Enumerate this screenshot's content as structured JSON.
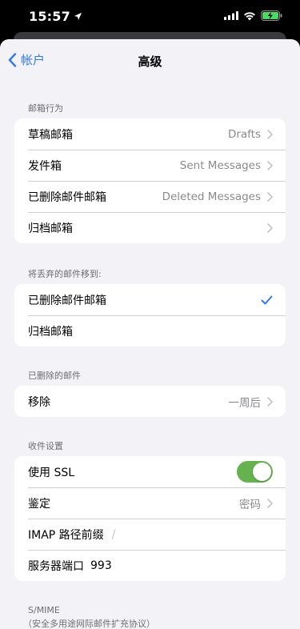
{
  "status_bar": {
    "time": "15:57",
    "icons": [
      "location-arrow-icon",
      "signal-icon",
      "wifi-icon",
      "battery-charging-icon"
    ]
  },
  "nav": {
    "back_label": "帐户",
    "title": "高级"
  },
  "mailbox_behaviors": {
    "header": "邮箱行为",
    "rows": [
      {
        "label": "草稿邮箱",
        "value": "Drafts"
      },
      {
        "label": "发件箱",
        "value": "Sent Messages"
      },
      {
        "label": "已删除邮件邮箱",
        "value": "Deleted Messages"
      },
      {
        "label": "归档邮箱",
        "value": ""
      }
    ]
  },
  "discard_move": {
    "header": "将丢弃的邮件移到:",
    "rows": [
      {
        "label": "已删除邮件邮箱",
        "selected": true
      },
      {
        "label": "归档邮箱",
        "selected": false
      }
    ]
  },
  "deleted_messages": {
    "header": "已删除的邮件",
    "rows": [
      {
        "label": "移除",
        "value": "一周后"
      }
    ]
  },
  "incoming_settings": {
    "header": "收件设置",
    "use_ssl": {
      "label": "使用 SSL",
      "on": true
    },
    "auth": {
      "label": "鉴定",
      "value": "密码"
    },
    "imap_prefix": {
      "label": "IMAP 路径前缀",
      "value": "/"
    },
    "server_port": {
      "label": "服务器端口",
      "value": "993"
    }
  },
  "smime": {
    "title": "S/MIME",
    "subtitle": "（安全多用途网际邮件扩充协议）"
  },
  "colors": {
    "accent": "#3478f6",
    "toggle_on": "#65b24f",
    "background": "#f2f2f7",
    "secondary_text": "#8a8a8e"
  }
}
